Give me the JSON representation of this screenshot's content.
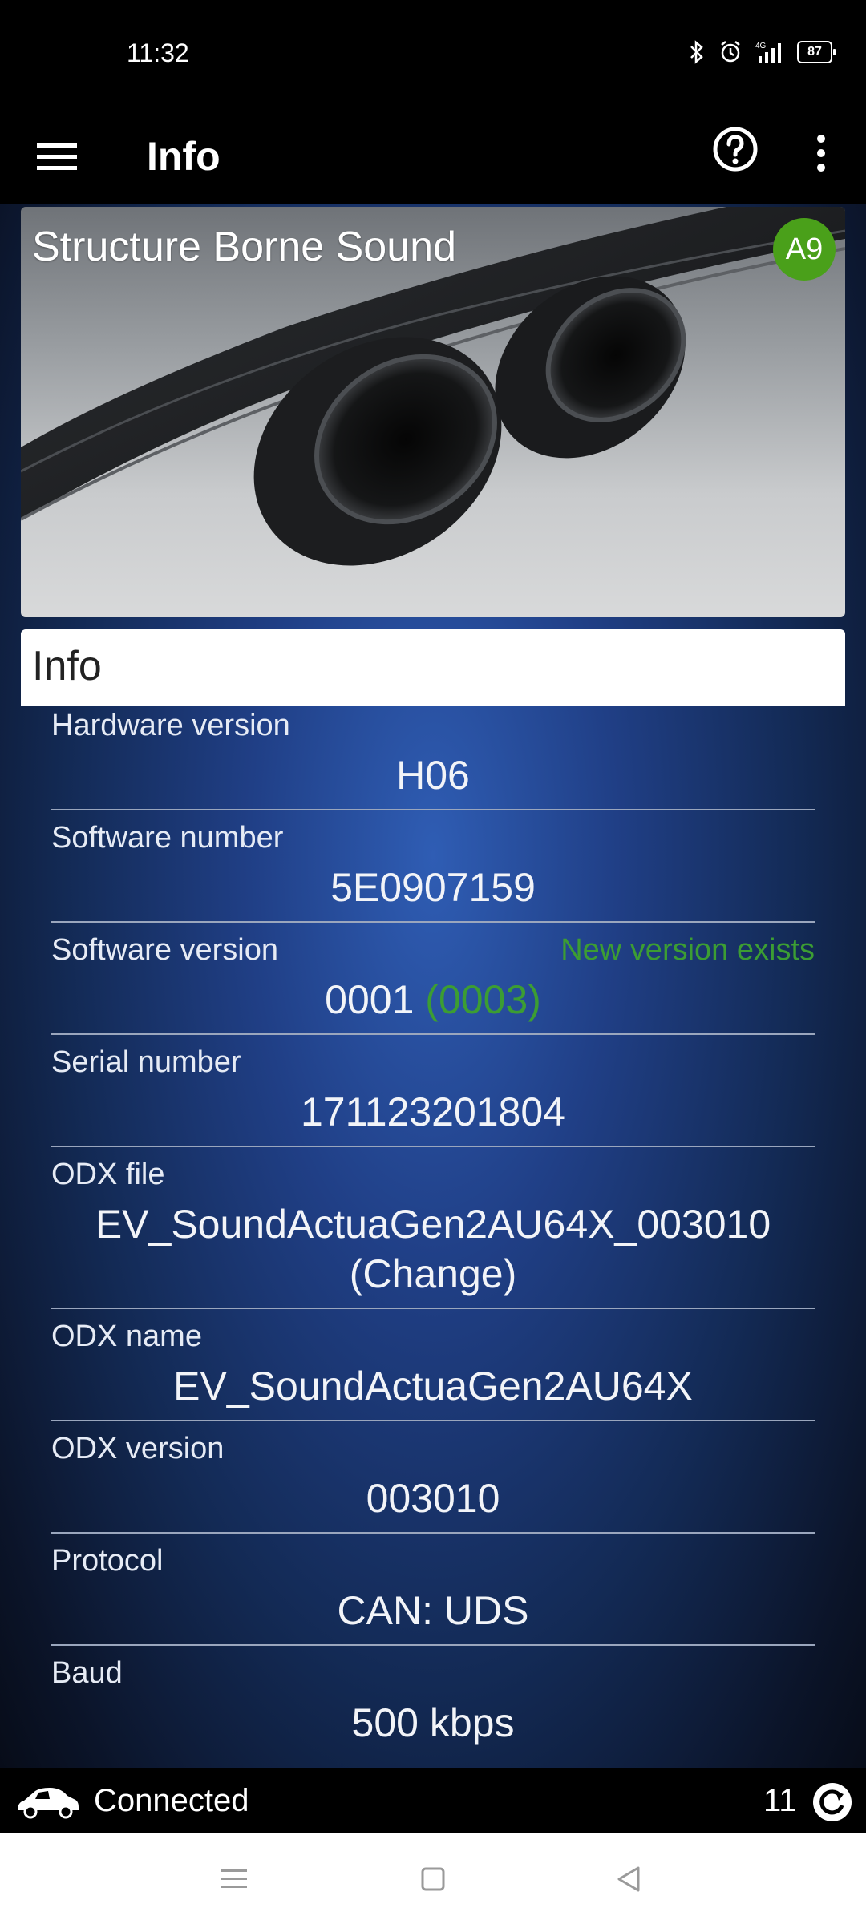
{
  "status": {
    "time": "11:32",
    "network": "4G",
    "battery": "87"
  },
  "appbar": {
    "title": "Info"
  },
  "hero": {
    "title": "Structure Borne Sound",
    "badge": "A9"
  },
  "info": {
    "header": "Info",
    "rows": [
      {
        "label": "Hardware version",
        "value": "H06"
      },
      {
        "label": "Software number",
        "value": "5E0907159"
      },
      {
        "label": "Software version",
        "value": "0001",
        "value_extra": "(0003)",
        "hint": "New version exists"
      },
      {
        "label": "Serial number",
        "value": "171123201804"
      },
      {
        "label": "ODX file",
        "value": "EV_SoundActuaGen2AU64X_003010",
        "value_extra": "(Change)"
      },
      {
        "label": "ODX name",
        "value": "EV_SoundActuaGen2AU64X"
      },
      {
        "label": "ODX version",
        "value": "003010"
      },
      {
        "label": "Protocol",
        "value": "CAN: UDS"
      },
      {
        "label": "Baud",
        "value": "500 kbps"
      }
    ]
  },
  "connection": {
    "status": "Connected",
    "count": "11"
  },
  "colors": {
    "accent_green": "#3c9d33",
    "badge_green": "#4aa01a",
    "background_blue": "#203f86"
  },
  "icons": [
    "menu-icon",
    "help-icon",
    "more-icon",
    "car-icon",
    "refresh-icon",
    "bluetooth-icon",
    "alarm-icon",
    "signal-icon",
    "battery-icon"
  ]
}
